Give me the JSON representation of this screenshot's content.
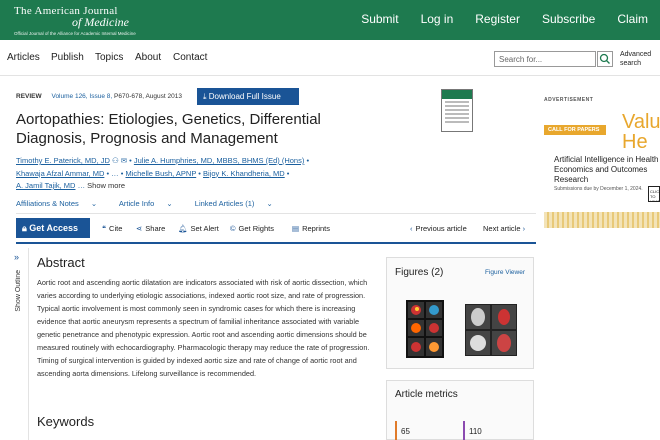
{
  "header": {
    "logo_line1": "The American Journal",
    "logo_line2": "of Medicine",
    "logo_line3": "Official Journal of the Alliance for Academic Internal Medicine",
    "nav": [
      "Submit",
      "Log in",
      "Register",
      "Subscribe",
      "Claim"
    ]
  },
  "mainnav": {
    "items": [
      "Articles",
      "Publish",
      "Topics",
      "About",
      "Contact"
    ],
    "search_placeholder": "Search for...",
    "advanced_search": "Advanced search"
  },
  "article": {
    "type": "REVIEW",
    "volume": "Volume 126, Issue 8,",
    "pages": "P670-678, August 2013",
    "download_label": "Download Full Issue",
    "title": "Aortopathies: Etiologies, Genetics, Differential Diagnosis, Prognosis and Management",
    "authors": [
      "Timothy E. Paterick, MD, JD",
      "Julie A. Humphries, MD, MBBS, BHMS (Ed) (Hons)",
      "Khawaja Afzal Ammar, MD",
      "Michelle Bush, APNP",
      "Bijoy K. Khandheria, MD",
      "A. Jamil Tajik, MD"
    ],
    "show_more": "Show more",
    "links": [
      "Affiliations & Notes",
      "Article Info",
      "Linked Articles (1)"
    ]
  },
  "toolbar": {
    "get_access": "Get Access",
    "cite": "Cite",
    "share": "Share",
    "set_alert": "Set Alert",
    "get_rights": "Get Rights",
    "reprints": "Reprints",
    "prev": "Previous article",
    "next": "Next article"
  },
  "outline": {
    "label": "Show Outline"
  },
  "abstract": {
    "heading": "Abstract",
    "text": "Aortic root and ascending aortic dilatation are indicators associated with risk of aortic dissection, which varies according to underlying etiologic associations, indexed aortic root size, and rate of progression. Typical aortic involvement is most commonly seen in syndromic cases for which there is increasing evidence that aortic aneurysm represents a spectrum of familial inheritance associated with variable genetic penetrance and phenotypic expression. Aortic root and ascending aortic dimensions should be measured routinely with echocardiography. Pharmacologic therapy may reduce the rate of progression. Timing of surgical intervention is guided by indexed aortic size and rate of change of aortic root and ascending aorta dimensions. Lifelong surveillance is recommended."
  },
  "keywords": {
    "heading": "Keywords"
  },
  "figures": {
    "heading": "Figures (2)",
    "viewer": "Figure Viewer"
  },
  "metrics": {
    "heading": "Article metrics",
    "values": [
      "65",
      "110"
    ],
    "colors": [
      "#e07b2a",
      "#8b4ab0"
    ]
  },
  "ad": {
    "label": "ADVERTISEMENT",
    "cfp": "CALL FOR PAPERS",
    "big": "Valu He",
    "title": "Artificial Intelligence in Health Economics and Outcomes Research",
    "sub": "Submissions due by December 1, 2024.",
    "btn": "CLICK TO LEARN"
  },
  "colors": {
    "brand_green": "#1e7a4f",
    "link_blue": "#1a5f9e",
    "button_blue": "#1a5496"
  }
}
